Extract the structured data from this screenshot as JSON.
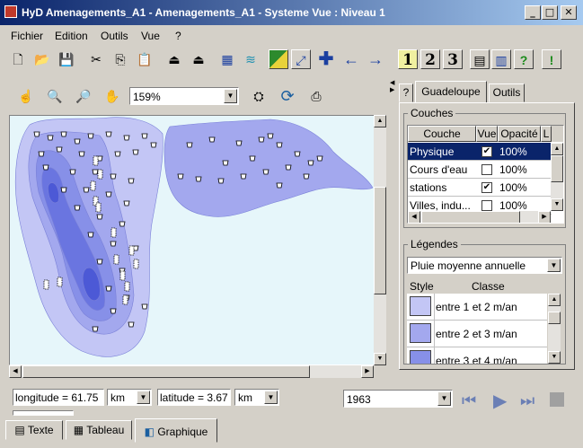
{
  "window": {
    "title": "HyD Amenagements_A1 - Amenagements_A1 - Systeme Vue  : Niveau 1"
  },
  "menu": [
    "Fichier",
    "Edition",
    "Outils",
    "Vue",
    "?"
  ],
  "toolbar_numbers": [
    "1",
    "2",
    "3"
  ],
  "map": {
    "zoom": "159%"
  },
  "tabs": {
    "help": "?",
    "region": "Guadeloupe",
    "tools": "Outils"
  },
  "layers": {
    "title": "Couches",
    "headers": [
      "Couche",
      "Vue",
      "Opacité",
      "L"
    ],
    "rows": [
      {
        "name": "Physique",
        "visible": true,
        "opacity": "100%",
        "selected": true
      },
      {
        "name": "Cours d'eau",
        "visible": false,
        "opacity": "100%",
        "selected": false
      },
      {
        "name": "stations",
        "visible": true,
        "opacity": "100%",
        "selected": false
      },
      {
        "name": "Villes, indu...",
        "visible": false,
        "opacity": "100%",
        "selected": false
      }
    ]
  },
  "legends": {
    "title": "Légendes",
    "selected": "Pluie moyenne annuelle",
    "headers": [
      "Style",
      "Classe"
    ],
    "items": [
      {
        "label": "entre 1 et 2 m/an",
        "color": "#c3c6f5"
      },
      {
        "label": "entre 2 et 3 m/an",
        "color": "#a3a8ee"
      },
      {
        "label": "entre 3 et 4 m/an",
        "color": "#8790e8"
      }
    ]
  },
  "coords": {
    "longitude": "longitude = 61.75",
    "lon_unit": "km",
    "latitude": "latitude = 3.67",
    "lat_unit": "km"
  },
  "year": "1963",
  "bottom_tabs": [
    "Texte",
    "Tableau",
    "Graphique"
  ],
  "colors": {
    "map_bg": "#e6f6fa",
    "zone1": "#c3c6f5",
    "zone2": "#a3a8ee",
    "zone3": "#8790e8",
    "zone4": "#6a75e0",
    "zone5": "#4c59d6",
    "selection": "#0a246a"
  }
}
